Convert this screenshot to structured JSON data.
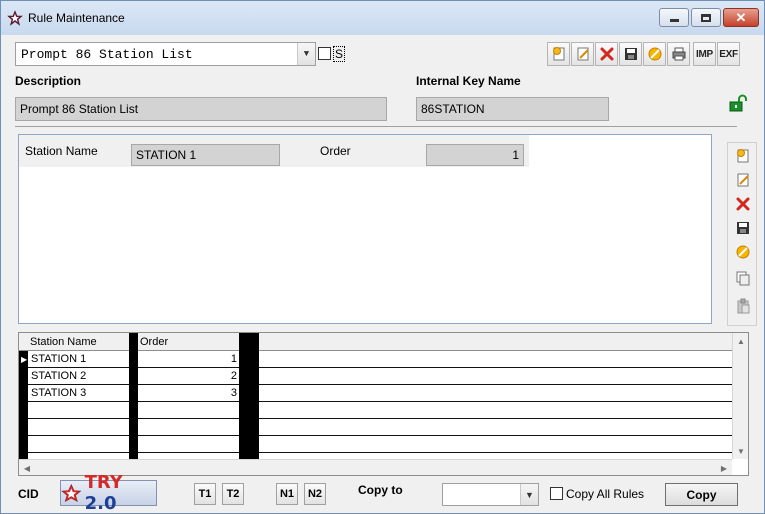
{
  "window": {
    "title": "Rule Maintenance"
  },
  "top": {
    "selected_rule": "Prompt 86 Station List",
    "s_label": "S"
  },
  "toolbar": {
    "imp_label": "IMP",
    "exp_label": "EXF"
  },
  "header": {
    "description_label": "Description",
    "description_value": "Prompt 86 Station List",
    "key_label": "Internal Key Name",
    "key_value": "86STATION"
  },
  "detail": {
    "station_label": "Station Name",
    "station_value": "STATION 1",
    "order_label": "Order",
    "order_value": "1"
  },
  "grid": {
    "columns": [
      "Station Name",
      "Order"
    ],
    "rows": [
      {
        "station": "STATION 1",
        "order": "1"
      },
      {
        "station": "STATION 2",
        "order": "2"
      },
      {
        "station": "STATION 3",
        "order": "3"
      }
    ]
  },
  "bottom": {
    "cid_label": "CID",
    "logo_text_1": "TRY",
    "logo_text_2": " 2.0",
    "t1": "T1",
    "t2": "T2",
    "n1": "N1",
    "n2": "N2",
    "copy_to_label": "Copy to",
    "copy_all_label": "Copy All Rules",
    "copy_button": "Copy"
  },
  "colors": {
    "accent_blue": "#1d3f95",
    "accent_red": "#d42a2a",
    "close_red": "#c4412b"
  }
}
